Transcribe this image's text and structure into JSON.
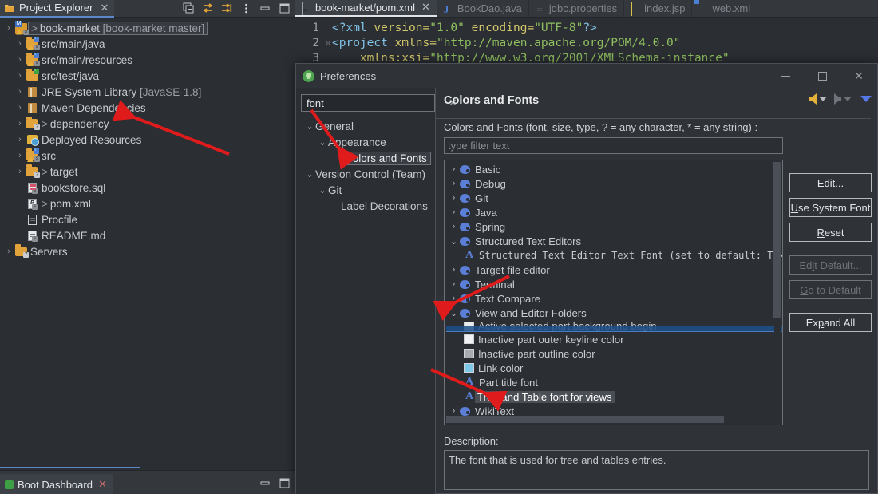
{
  "project_explorer": {
    "tab_label": "Project Explorer",
    "tab_close": "✕",
    "toolbar_icons": [
      "collapse-all-icon",
      "link-with-editor-icon",
      "focus-active-task-icon",
      "view-menu-icon",
      "minimize-icon",
      "maximize-icon"
    ],
    "tree": [
      {
        "label": "book-market [book-market master]",
        "prefix": ">",
        "icon": "maven-project-icon",
        "indent": 0,
        "expandable": true,
        "selected": true
      },
      {
        "label": "src/main/java",
        "prefix": "",
        "icon": "source-folder-warning-icon",
        "indent": 1,
        "expandable": true,
        "selected": false
      },
      {
        "label": "src/main/resources",
        "prefix": "",
        "icon": "source-folder-warning-icon",
        "indent": 1,
        "expandable": true,
        "selected": false
      },
      {
        "label": "src/test/java",
        "prefix": "",
        "icon": "test-source-folder-icon",
        "indent": 1,
        "expandable": true,
        "selected": false
      },
      {
        "label": "JRE System Library [JavaSE-1.8]",
        "prefix": "",
        "icon": "library-icon",
        "indent": 1,
        "expandable": true,
        "selected": false
      },
      {
        "label": "Maven Dependencies",
        "prefix": "",
        "icon": "library-icon",
        "indent": 1,
        "expandable": true,
        "selected": false
      },
      {
        "label": "dependency",
        "prefix": ">",
        "icon": "folder-icon",
        "indent": 1,
        "expandable": true,
        "selected": false
      },
      {
        "label": "Deployed Resources",
        "prefix": "",
        "icon": "deployed-resources-icon",
        "indent": 1,
        "expandable": true,
        "selected": false
      },
      {
        "label": "src",
        "prefix": "",
        "icon": "source-folder-warning-icon",
        "indent": 1,
        "expandable": true,
        "selected": false
      },
      {
        "label": "target",
        "prefix": ">",
        "icon": "folder-icon",
        "indent": 1,
        "expandable": true,
        "selected": false
      },
      {
        "label": "bookstore.sql",
        "prefix": "",
        "icon": "sql-file-icon",
        "indent": 1,
        "expandable": false,
        "selected": false
      },
      {
        "label": "pom.xml",
        "prefix": ">",
        "icon": "pom-file-icon",
        "indent": 1,
        "expandable": false,
        "selected": false
      },
      {
        "label": "Procfile",
        "prefix": "",
        "icon": "text-file-icon",
        "indent": 1,
        "expandable": false,
        "selected": false
      },
      {
        "label": "README.md",
        "prefix": "",
        "icon": "markdown-file-icon",
        "indent": 1,
        "expandable": false,
        "selected": false
      },
      {
        "label": "Servers",
        "prefix": "",
        "icon": "folder-icon",
        "indent": 0,
        "expandable": true,
        "selected": false
      }
    ],
    "boot_dashboard_tab": "Boot Dashboard"
  },
  "editor": {
    "tabs": [
      {
        "label": "book-market/pom.xml",
        "icon": "pom-file-icon",
        "active": true,
        "closable": true
      },
      {
        "label": "BookDao.java",
        "icon": "java-file-icon",
        "active": false,
        "closable": false
      },
      {
        "label": "jdbc.properties",
        "icon": "properties-file-icon",
        "active": false,
        "closable": false
      },
      {
        "label": "index.jsp",
        "icon": "jsp-file-icon",
        "active": false,
        "closable": false
      },
      {
        "label": "web.xml",
        "icon": "webxml-file-icon",
        "active": false,
        "closable": false
      }
    ],
    "lines": [
      {
        "num": "1",
        "fold": "",
        "segments": [
          {
            "t": "<?xml ",
            "c": "tk-pi"
          },
          {
            "t": "version=",
            "c": "tk-attr"
          },
          {
            "t": "\"1.0\"",
            "c": "tk-str"
          },
          {
            "t": " encoding=",
            "c": "tk-attr"
          },
          {
            "t": "\"UTF-8\"",
            "c": "tk-str"
          },
          {
            "t": "?>",
            "c": "tk-pi"
          }
        ]
      },
      {
        "num": "2",
        "fold": "⊖",
        "segments": [
          {
            "t": "<project ",
            "c": "tk-tag"
          },
          {
            "t": "xmlns=",
            "c": "tk-attr"
          },
          {
            "t": "\"http://maven.apache.org/POM/4.0.0\"",
            "c": "tk-str"
          }
        ]
      },
      {
        "num": "3",
        "fold": "",
        "segments": [
          {
            "t": "    xmlns:xsi=",
            "c": "tk-attr"
          },
          {
            "t": "\"http://www.w3.org/2001/XMLSchema-instance\"",
            "c": "tk-str"
          }
        ]
      }
    ]
  },
  "preferences": {
    "title": "Preferences",
    "window_controls": {
      "minimize": "minimize-icon",
      "maximize": "maximize-icon",
      "close": "✕"
    },
    "search": {
      "value": "font",
      "placeholder": "type filter text",
      "clear": "✕"
    },
    "nav_tree": [
      {
        "label": "General",
        "indent": 0,
        "chevron": "⌄",
        "selected": false
      },
      {
        "label": "Appearance",
        "indent": 1,
        "chevron": "⌄",
        "selected": false
      },
      {
        "label": "Colors and Fonts",
        "indent": 2,
        "chevron": "",
        "selected": true
      },
      {
        "label": "Version Control (Team)",
        "indent": 0,
        "chevron": "⌄",
        "selected": false
      },
      {
        "label": "Git",
        "indent": 1,
        "chevron": "⌄",
        "selected": false
      },
      {
        "label": "Label Decorations",
        "indent": 2,
        "chevron": "",
        "selected": false
      }
    ],
    "page_title": "Colors and Fonts",
    "nav_buttons": {
      "back": "back-arrow-icon",
      "forward": "forward-arrow-icon",
      "menu": "dropdown-arrow-icon"
    },
    "caption": "Colors and Fonts (font, size, type, ? = any character, * = any string) :",
    "filter_placeholder": "type filter text",
    "color_font_tree": [
      {
        "label": "Basic",
        "type": "palette",
        "indent": 0,
        "chevron": "›",
        "state": "normal"
      },
      {
        "label": "Debug",
        "type": "palette",
        "indent": 0,
        "chevron": "›",
        "state": "normal"
      },
      {
        "label": "Git",
        "type": "palette",
        "indent": 0,
        "chevron": "›",
        "state": "normal"
      },
      {
        "label": "Java",
        "type": "palette",
        "indent": 0,
        "chevron": "›",
        "state": "normal"
      },
      {
        "label": "Spring",
        "type": "palette",
        "indent": 0,
        "chevron": "›",
        "state": "normal"
      },
      {
        "label": "Structured Text Editors",
        "type": "palette",
        "indent": 0,
        "chevron": "⌄",
        "state": "normal"
      },
      {
        "label": "Structured Text Editor Text Font (set to default: Text Font)",
        "type": "font",
        "indent": 1,
        "chevron": "",
        "state": "mono"
      },
      {
        "label": "Target file editor",
        "type": "palette",
        "indent": 0,
        "chevron": "›",
        "state": "normal"
      },
      {
        "label": "Terminal",
        "type": "palette",
        "indent": 0,
        "chevron": "›",
        "state": "normal"
      },
      {
        "label": "Text Compare",
        "type": "palette",
        "indent": 0,
        "chevron": "›",
        "state": "normal"
      },
      {
        "label": "View and Editor Folders",
        "type": "palette",
        "indent": 0,
        "chevron": "⌄",
        "state": "normal"
      },
      {
        "label": "Active selected part background begin",
        "type": "color",
        "indent": 1,
        "chevron": "",
        "state": "clipped",
        "swatch": "#e8eaec"
      },
      {
        "label": "Inactive part outer keyline color",
        "type": "color",
        "indent": 1,
        "chevron": "",
        "state": "normal",
        "swatch": "#f0f2f4"
      },
      {
        "label": "Inactive part outline color",
        "type": "color",
        "indent": 1,
        "chevron": "",
        "state": "normal",
        "swatch": "#a8acb1"
      },
      {
        "label": "Link color",
        "type": "color",
        "indent": 1,
        "chevron": "",
        "state": "normal",
        "swatch": "#7ec8ea"
      },
      {
        "label": "Part title font",
        "type": "font",
        "indent": 1,
        "chevron": "",
        "state": "normal"
      },
      {
        "label": "Tree and Table font for views",
        "type": "font",
        "indent": 1,
        "chevron": "",
        "state": "selected"
      },
      {
        "label": "WikiText",
        "type": "palette",
        "indent": 0,
        "chevron": "›",
        "state": "normal"
      }
    ],
    "buttons": [
      {
        "label": "Edit...",
        "mnemonic": "E",
        "enabled": true
      },
      {
        "label": "Use System Font",
        "mnemonic": "U",
        "enabled": true
      },
      {
        "label": "Reset",
        "mnemonic": "R",
        "enabled": true
      },
      {
        "label": "Edit Default...",
        "mnemonic": "i",
        "enabled": false
      },
      {
        "label": "Go to Default",
        "mnemonic": "G",
        "enabled": false
      },
      {
        "label": "Expand All",
        "mnemonic": "p",
        "enabled": true
      }
    ],
    "description_label": "Description:",
    "description_text": "The font that is used for tree and tables entries."
  },
  "colors": {
    "accent_blue": "#5a88c8",
    "selection_blue": "#1d4f8a",
    "annotation_red": "#e01b1b",
    "folder_orange": "#e2a33a",
    "palette_blue": "#5b7fd6"
  }
}
